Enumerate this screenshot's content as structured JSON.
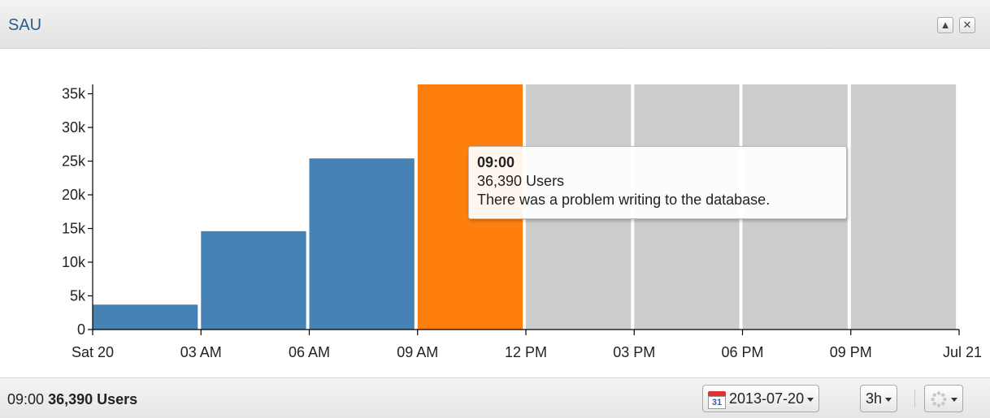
{
  "window": {
    "title": "SAU",
    "buttons": {
      "collapse": "▲",
      "close": "✕"
    }
  },
  "chart_data": {
    "type": "bar",
    "ylim": [
      0,
      36390
    ],
    "yticks": [
      "0",
      "5k",
      "10k",
      "15k",
      "20k",
      "25k",
      "30k",
      "35k"
    ],
    "ytick_values": [
      0,
      5000,
      10000,
      15000,
      20000,
      25000,
      30000,
      35000
    ],
    "xticks": [
      "Sat 20",
      "03 AM",
      "06 AM",
      "09 AM",
      "12 PM",
      "03 PM",
      "06 PM",
      "09 PM",
      "Jul 21"
    ],
    "categories": [
      "00:00",
      "03:00",
      "06:00",
      "09:00",
      "12:00",
      "15:00",
      "18:00",
      "21:00"
    ],
    "values": [
      3700,
      14600,
      25400,
      36390,
      null,
      null,
      null,
      null
    ],
    "states": [
      "normal",
      "normal",
      "normal",
      "highlighted",
      "empty",
      "empty",
      "empty",
      "empty"
    ],
    "colors": {
      "normal": "#4682b4",
      "highlighted": "#ff7f0e",
      "empty": "#cccccc"
    }
  },
  "tooltip": {
    "time": "09:00",
    "value": "36,390 Users",
    "message": "There was a problem writing to the database."
  },
  "footer": {
    "status_time": "09:00",
    "status_value": "36,390 Users",
    "date": "2013-07-20",
    "calendar_day": "31",
    "interval": "3h"
  }
}
